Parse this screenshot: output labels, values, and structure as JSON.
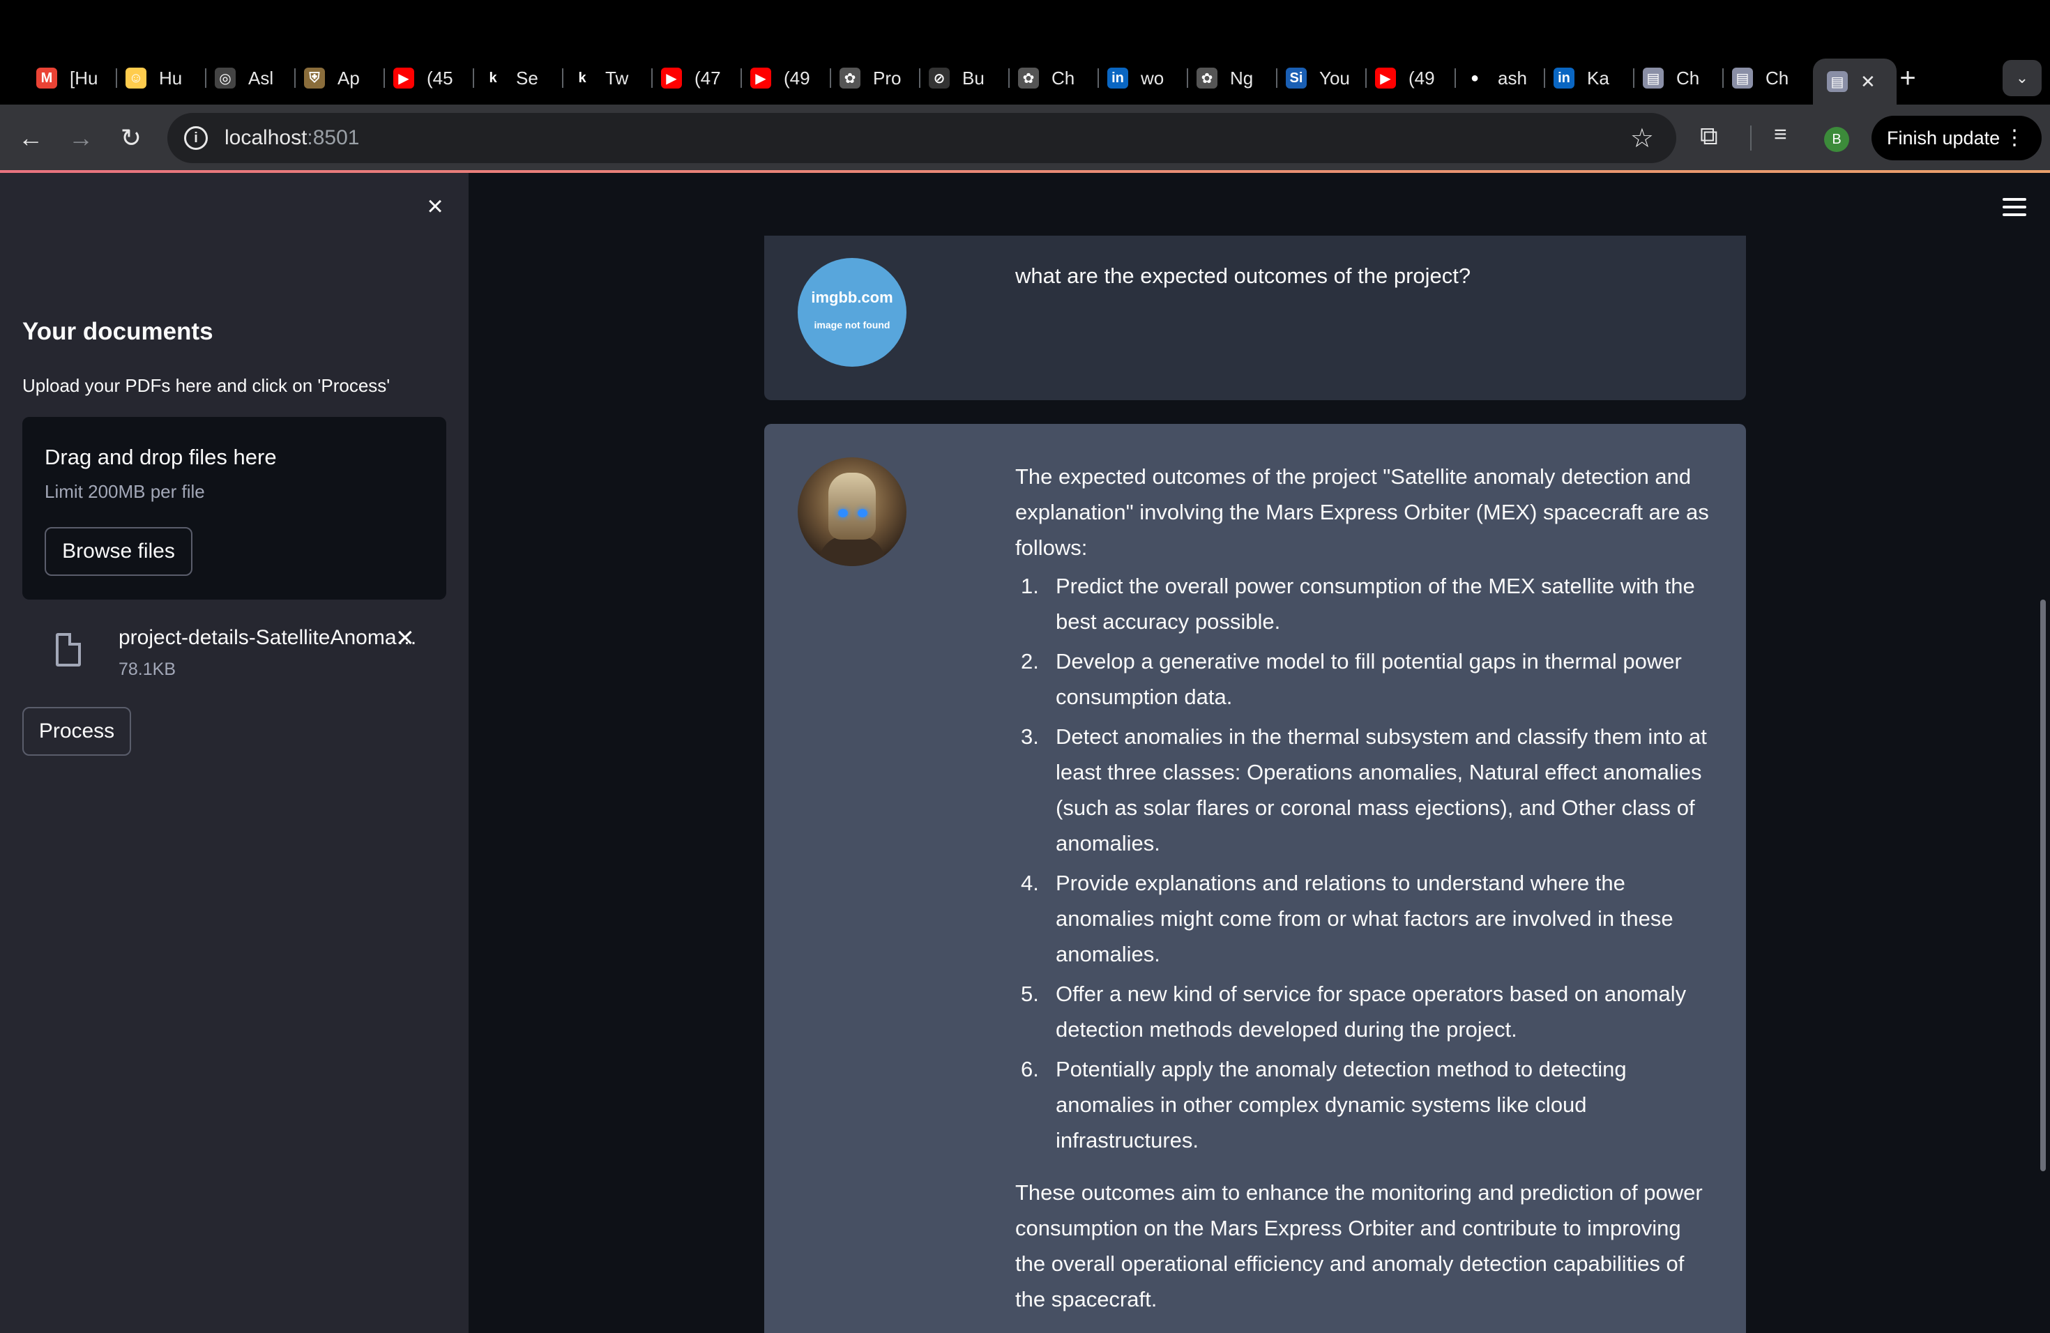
{
  "browser": {
    "tabs": [
      {
        "label": "[Hu",
        "icon": "gmail-icon",
        "color": "#ea4335",
        "glyph": "M"
      },
      {
        "label": "Hu",
        "icon": "huggingface-icon",
        "color": "#ffcc4d",
        "glyph": "☺"
      },
      {
        "label": "Asl",
        "icon": "openai-icon",
        "color": "#444",
        "glyph": "◎"
      },
      {
        "label": "Ap",
        "icon": "porsche-icon",
        "color": "#8a6d3b",
        "glyph": "⛨"
      },
      {
        "label": "(45",
        "icon": "youtube-icon",
        "color": "#ff0000",
        "glyph": "▶"
      },
      {
        "label": "Se",
        "icon": "kaggle-icon",
        "color": "#000",
        "glyph": "k"
      },
      {
        "label": "Tw",
        "icon": "kaggle-icon",
        "color": "#000",
        "glyph": "k"
      },
      {
        "label": "(47",
        "icon": "youtube-icon",
        "color": "#ff0000",
        "glyph": "▶"
      },
      {
        "label": "(49",
        "icon": "youtube-icon",
        "color": "#ff0000",
        "glyph": "▶"
      },
      {
        "label": "Pro",
        "icon": "chatgpt-icon",
        "color": "#555",
        "glyph": "✿"
      },
      {
        "label": "Bu",
        "icon": "compass-icon",
        "color": "#333",
        "glyph": "⊘"
      },
      {
        "label": "Ch",
        "icon": "chatgpt-icon",
        "color": "#555",
        "glyph": "✿"
      },
      {
        "label": "wo",
        "icon": "linkedin-icon",
        "color": "#0a66c2",
        "glyph": "in"
      },
      {
        "label": "Ng",
        "icon": "chatgpt-icon",
        "color": "#555",
        "glyph": "✿"
      },
      {
        "label": "You",
        "icon": "si-icon",
        "color": "#1a5fb4",
        "glyph": "Si"
      },
      {
        "label": "(49",
        "icon": "youtube-icon",
        "color": "#ff0000",
        "glyph": "▶"
      },
      {
        "label": "ash",
        "icon": "github-icon",
        "color": "#000",
        "glyph": "●"
      },
      {
        "label": "Ka",
        "icon": "linkedin-icon",
        "color": "#0a66c2",
        "glyph": "in"
      },
      {
        "label": "Ch",
        "icon": "streamlit-icon",
        "color": "#8a8fa6",
        "glyph": "▤"
      },
      {
        "label": "Ch",
        "icon": "streamlit-icon",
        "color": "#8a8fa6",
        "glyph": "▤"
      },
      {
        "label": "",
        "icon": "streamlit-icon",
        "color": "#8a8fa6",
        "glyph": "▤"
      }
    ],
    "active_tab_close": "✕",
    "new_tab": "+",
    "url_host": "localhost",
    "url_port": ":8501",
    "profile_initial": "B",
    "finish_update": "Finish update"
  },
  "sidebar": {
    "title": "Your documents",
    "subtitle": "Upload your PDFs here and click on 'Process'",
    "dropzone_title": "Drag and drop files here",
    "dropzone_limit": "Limit 200MB per file",
    "browse_label": "Browse files",
    "file_name": "project-details-SatelliteAnomalyDetection.pdf",
    "file_size": "78.1KB",
    "process_label": "Process"
  },
  "chat": {
    "user_avatar_line1": "imgbb.com",
    "user_avatar_line2": "image not found",
    "user_message": "what are the expected outcomes of the project?",
    "bot_intro": "The expected outcomes of the project \"Satellite anomaly detection and explanation\" involving the Mars Express Orbiter (MEX) spacecraft are as follows:",
    "bot_items": [
      {
        "num": "1.",
        "text": "Predict the overall power consumption of the MEX satellite with the best accuracy possible."
      },
      {
        "num": "2.",
        "text": "Develop a generative model to fill potential gaps in thermal power consumption data."
      },
      {
        "num": "3.",
        "text": "Detect anomalies in the thermal subsystem and classify them into at least three classes: Operations anomalies, Natural effect anomalies (such as solar flares or coronal mass ejections), and Other class of anomalies."
      },
      {
        "num": "4.",
        "text": "Provide explanations and relations to understand where the anomalies might come from or what factors are involved in these anomalies."
      },
      {
        "num": "5.",
        "text": "Offer a new kind of service for space operators based on anomaly detection methods developed during the project."
      },
      {
        "num": "6.",
        "text": "Potentially apply the anomaly detection method to detecting anomalies in other complex dynamic systems like cloud infrastructures."
      }
    ],
    "bot_outro": "These outcomes aim to enhance the monitoring and prediction of power consumption on the Mars Express Orbiter and contribute to improving the overall operational efficiency and anomaly detection capabilities of the spacecraft."
  },
  "colors": {
    "app_bg": "#0e1117",
    "sidebar_bg": "#262730",
    "user_msg_bg": "#2b313e",
    "bot_msg_bg": "#475063",
    "user_avatar": "#58a6dc"
  }
}
